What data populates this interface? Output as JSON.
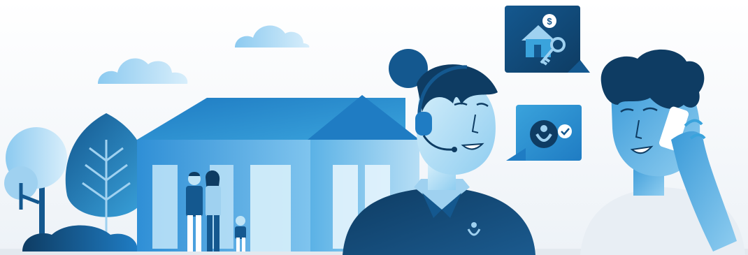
{
  "scene": {
    "description_free": true,
    "palette": {
      "sky_top": "#ffffff",
      "sky_bottom": "#eef3f8",
      "light_blue": "#9fd1f0",
      "mid_blue": "#3aa3dc",
      "blue": "#1f7cc3",
      "deep_blue": "#14588f",
      "navy": "#0e3c63",
      "skin": "#bfe4f7",
      "ground": "#e7edf3"
    },
    "icons": {
      "house_card": "house-with-key-and-dollar-icon",
      "check_card": "member-logo-with-check-icon",
      "dollar_symbol": "$"
    }
  }
}
